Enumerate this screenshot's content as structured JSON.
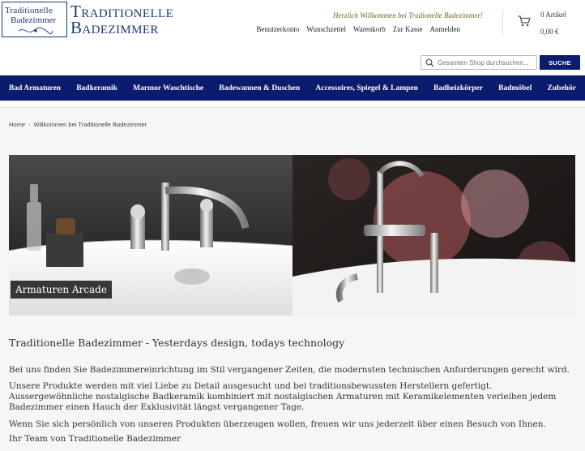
{
  "logo": {
    "line1": "Traditionelle",
    "line2": "Badezimmer"
  },
  "brand": {
    "line1": "Traditionelle",
    "line2": "Badezimmer"
  },
  "header": {
    "welcome": "Herzlich Willkommen bei Tradionelle Badezimmer!",
    "links": [
      "Benutzerkonto",
      "Wunschzettel",
      "Warenkorb",
      "Zur Kasse",
      "Anmelden"
    ]
  },
  "cart": {
    "count": "0 Artikel",
    "total": "0,00 €"
  },
  "search": {
    "placeholder": "Gesamten Shop durchsuchen...",
    "button": "SUCHE"
  },
  "nav": {
    "items": [
      "Bad Armaturen",
      "Badkeramik",
      "Marmor Waschtische",
      "Badewannen & Duschen",
      "Accessoires, Spiegel & Lampen",
      "Badheizkörper",
      "Badmöbel",
      "Zubehör"
    ]
  },
  "breadcrumb": {
    "home": "Home",
    "separator": "›",
    "current": "Willkommen bei Traditionelle Badezimmer"
  },
  "hero": {
    "caption": "Armaturen Arcade"
  },
  "content": {
    "title": "Traditionelle Badezimmer - Yesterdays design, todays technology",
    "p1": "Bei uns finden Sie Badezimmereinrichtung im Stil vergangener Zeiten, die modernsten technischen Anforderungen gerecht wird.",
    "p2": "Unsere Produkte werden mit viel Liebe zu Detail ausgesucht und bei traditionsbewussten Herstellern gefertigt. Aussergewöhnliche nostalgische Badkeramik kombiniert mit nostalgischen Armaturen mit Keramikelementen verleihen jedem Badezimmer einen Hauch der Exklusivität längst vergangener Tage.",
    "p3": "Wenn Sie sich persönlich von unseren Produkten überzeugen wollen, freuen wir uns jederzeit über einen Besuch von Ihnen.",
    "p4": "Ihr Team von Traditionelle Badezimmer"
  },
  "colors": {
    "brand": "#1b3a7a",
    "nav_bg": "#0b1b6e",
    "button_bg": "#0d1c6e",
    "welcome_text": "#7a5a2a",
    "panel_bg": "#f6f6f6"
  },
  "icons": {
    "cart": "shopping-cart-icon",
    "search": "search-icon",
    "logo_ornament": "ornament-icon"
  }
}
